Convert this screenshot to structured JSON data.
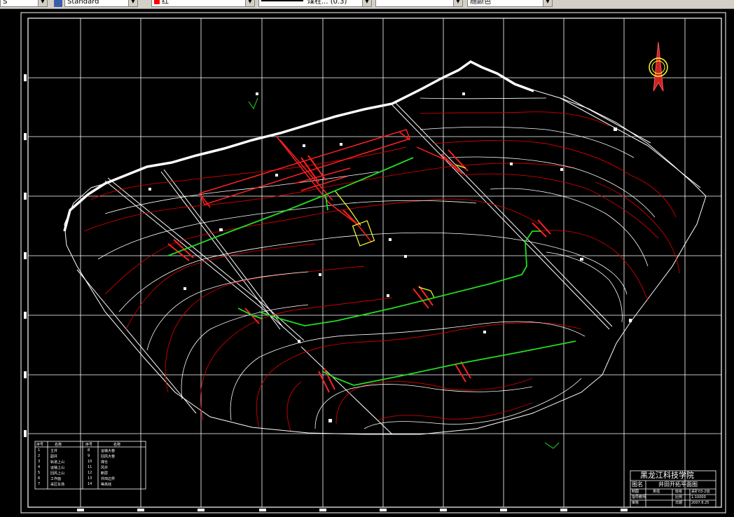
{
  "toolbar": {
    "field1_value": "S",
    "textstyle_value": "Standard",
    "color_value": "红",
    "linetype_value": "煤柱... (0.3)",
    "lineweight_value": "",
    "plotstyle_value": "随颜色"
  },
  "title_block": {
    "institution": "黑龙江科技学院",
    "label_name": "图名",
    "drawing_name": "井田开拓平面图",
    "row1": [
      "制图",
      "吴强",
      "班级",
      "采矿03-2班"
    ],
    "row2": [
      "指导教师",
      "",
      "比例",
      "1:10000"
    ],
    "row3": [
      "审核",
      "",
      "日期",
      "2007.6.25"
    ]
  },
  "legend": {
    "headers": [
      "序号",
      "名称",
      "序号",
      "名称"
    ],
    "rows": [
      [
        "1",
        "主井",
        "8",
        "运输大巷"
      ],
      [
        "2",
        "副井",
        "9",
        "回风大巷"
      ],
      [
        "3",
        "轨道上山",
        "10",
        "煤仓"
      ],
      [
        "4",
        "运输上山",
        "11",
        "风井"
      ],
      [
        "5",
        "回风上山",
        "12",
        "断层"
      ],
      [
        "6",
        "工作面",
        "13",
        "井田边界"
      ],
      [
        "7",
        "采区车场",
        "14",
        "等高线"
      ]
    ]
  },
  "colors": {
    "background": "#000000",
    "grid": "#ffffff",
    "contour_red": "#cc0000",
    "roadway_green": "#22dd22",
    "facility_red": "#ff2020",
    "accent_yellow": "#ffff33"
  },
  "icons": {
    "north_arrow": "north-arrow-icon"
  }
}
